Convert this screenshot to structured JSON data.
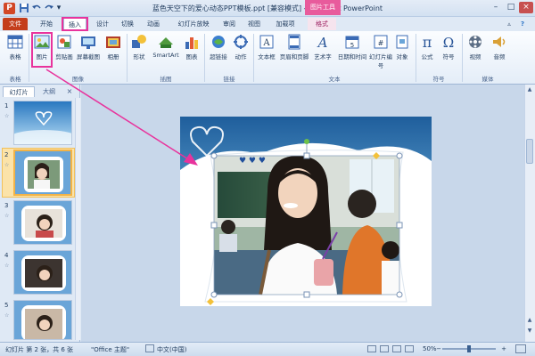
{
  "window": {
    "title": "蓝色天空下的爱心动态PPT模板.ppt [兼容模式] - Microsoft PowerPoint",
    "contextual_tab_group": "图片工具",
    "quick_access": [
      "save-icon",
      "undo-icon",
      "redo-icon"
    ]
  },
  "tabs": {
    "file": "文件",
    "items": [
      "开始",
      "插入",
      "设计",
      "切换",
      "动画",
      "幻灯片放映",
      "审阅",
      "视图",
      "加载项",
      "格式"
    ],
    "active": "插入"
  },
  "ribbon": {
    "buttons": [
      "表格",
      "图片",
      "剪贴画",
      "屏幕截图",
      "相册",
      "形状",
      "SmartArt",
      "图表",
      "超链接",
      "动作",
      "文本框",
      "页眉和页脚",
      "艺术字",
      "日期和时间",
      "幻灯片编号",
      "对象",
      "公式",
      "符号",
      "视频",
      "音频"
    ],
    "groups": [
      "表格",
      "图像",
      "插图",
      "链接",
      "文本",
      "符号",
      "媒体"
    ]
  },
  "left_pane": {
    "tabs": [
      "幻灯片",
      "大纲"
    ],
    "close": "×",
    "thumbnails": [
      "1",
      "2",
      "3",
      "4",
      "5"
    ],
    "selected": "2"
  },
  "status": {
    "slide_info": "幻灯片 第 2 张，共 6 张",
    "theme": "\"Office 主题\"",
    "language": "中文(中国)",
    "zoom": "50%",
    "zoom_fraction": 0.5
  },
  "colors": {
    "accent": "#e8339c",
    "file_tab": "#c43e1c",
    "ribbon_bg": "#e4edf8"
  }
}
